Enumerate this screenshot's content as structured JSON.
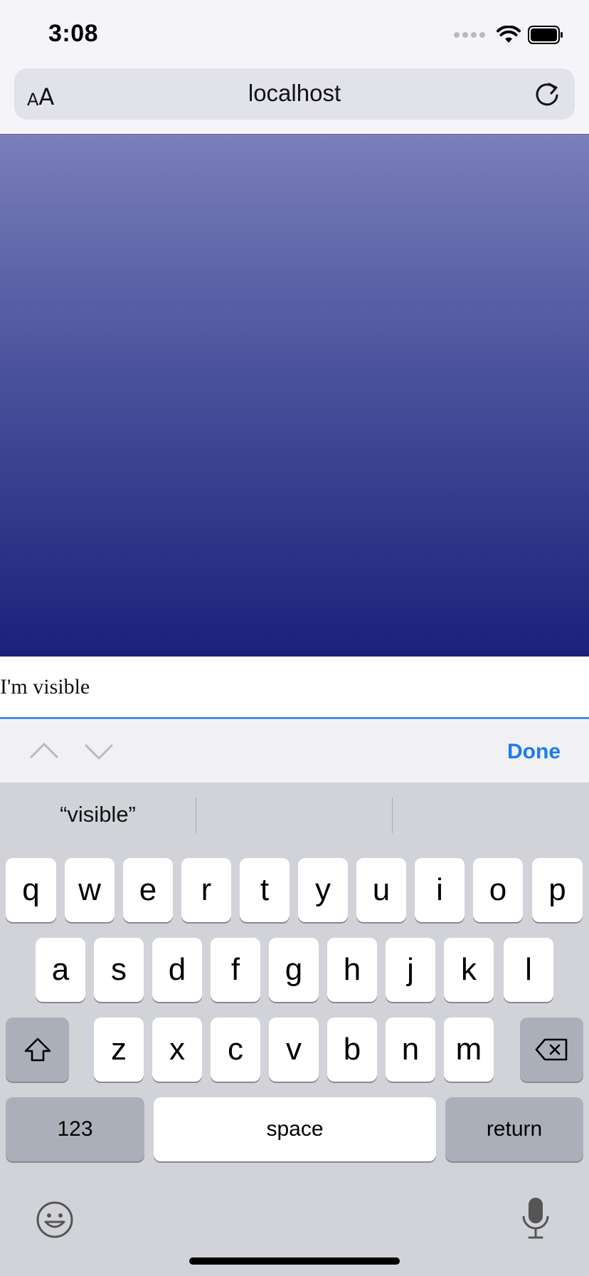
{
  "status_bar": {
    "time": "3:08"
  },
  "browser": {
    "aa_small": "A",
    "aa_big": "A",
    "url": "localhost"
  },
  "content": {
    "text_field_value": "I'm visible"
  },
  "accessory": {
    "done_label": "Done"
  },
  "keyboard": {
    "suggestions": [
      "“visible”",
      "",
      ""
    ],
    "row1": [
      "q",
      "w",
      "e",
      "r",
      "t",
      "y",
      "u",
      "i",
      "o",
      "p"
    ],
    "row2": [
      "a",
      "s",
      "d",
      "f",
      "g",
      "h",
      "j",
      "k",
      "l"
    ],
    "row3": [
      "z",
      "x",
      "c",
      "v",
      "b",
      "n",
      "m"
    ],
    "numbers_label": "123",
    "space_label": "space",
    "return_label": "return"
  },
  "colors": {
    "accent": "#1b7cf0",
    "gradient_top": "#7a7eba",
    "gradient_bottom": "#1a217a",
    "field_underline": "#3e8ede"
  },
  "icons": [
    "wifi-icon",
    "battery-icon",
    "reload-icon",
    "chevron-up-icon",
    "chevron-down-icon",
    "shift-icon",
    "backspace-icon",
    "emoji-icon",
    "microphone-icon"
  ]
}
